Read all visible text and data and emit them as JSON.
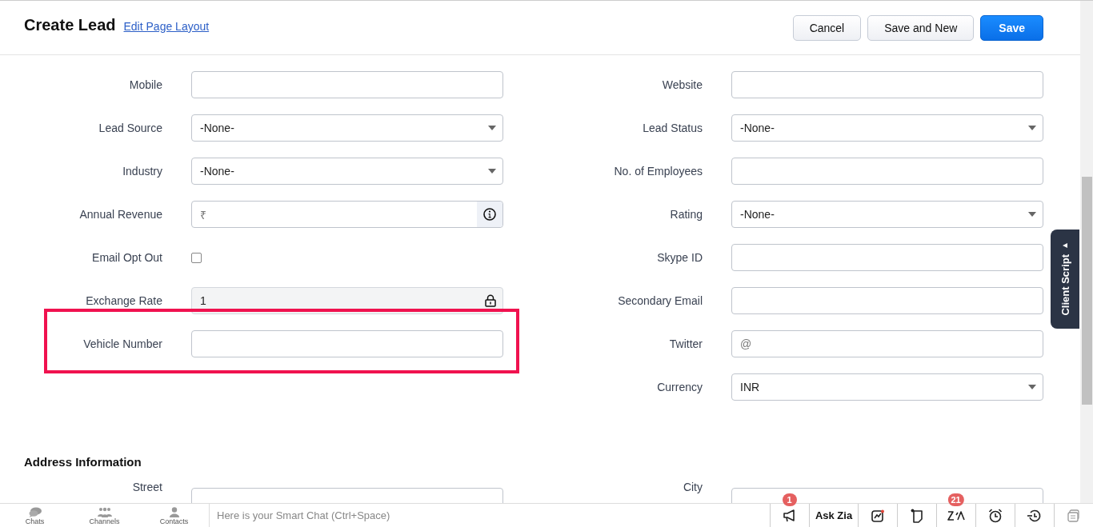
{
  "header": {
    "title": "Create Lead",
    "edit_link": "Edit Page Layout",
    "buttons": [
      {
        "label": "Cancel",
        "kind": "secondary"
      },
      {
        "label": "Save and New",
        "kind": "secondary"
      },
      {
        "label": "Save",
        "kind": "primary"
      }
    ]
  },
  "left_fields": [
    {
      "label": "Mobile",
      "kind": "text",
      "highlighted": false
    },
    {
      "label": "Lead Source",
      "kind": "select",
      "value": "-None-",
      "highlighted": false
    },
    {
      "label": "Industry",
      "kind": "select",
      "value": "-None-",
      "highlighted": false
    },
    {
      "label": "Annual Revenue",
      "kind": "currency",
      "prefix": "₹",
      "highlighted": false
    },
    {
      "label": "Email Opt Out",
      "kind": "checkbox",
      "checked": false,
      "highlighted": false
    },
    {
      "label": "Exchange Rate",
      "kind": "locked",
      "value": "1",
      "highlighted": false
    },
    {
      "label": "Vehicle Number",
      "kind": "text",
      "highlighted": true
    }
  ],
  "right_fields": [
    {
      "label": "Website",
      "kind": "text"
    },
    {
      "label": "Lead Status",
      "kind": "select",
      "value": "-None-"
    },
    {
      "label": "No. of Employees",
      "kind": "text"
    },
    {
      "label": "Rating",
      "kind": "select",
      "value": "-None-"
    },
    {
      "label": "Skype ID",
      "kind": "text"
    },
    {
      "label": "Secondary Email",
      "kind": "text"
    },
    {
      "label": "Twitter",
      "kind": "prefixed",
      "prefix": "@"
    },
    {
      "label": "Currency",
      "kind": "select",
      "value": "INR"
    }
  ],
  "address": {
    "title": "Address Information",
    "left_fields": [
      {
        "label": "Street",
        "kind": "text"
      }
    ],
    "right_fields": [
      {
        "label": "City",
        "kind": "text"
      }
    ]
  },
  "client_script_tab": {
    "label": "Client Script"
  },
  "bottom_bar": {
    "nav": [
      {
        "label": "Chats"
      },
      {
        "label": "Channels"
      },
      {
        "label": "Contacts"
      }
    ],
    "chat_placeholder": "Here is your Smart Chat (Ctrl+Space)",
    "tools": [
      {
        "kind": "icon",
        "badge": "1"
      },
      {
        "kind": "text",
        "label": "Ask Zia"
      },
      {
        "kind": "icon"
      },
      {
        "kind": "icon"
      },
      {
        "kind": "icon",
        "badge": "21"
      },
      {
        "kind": "icon"
      },
      {
        "kind": "icon"
      }
    ]
  }
}
